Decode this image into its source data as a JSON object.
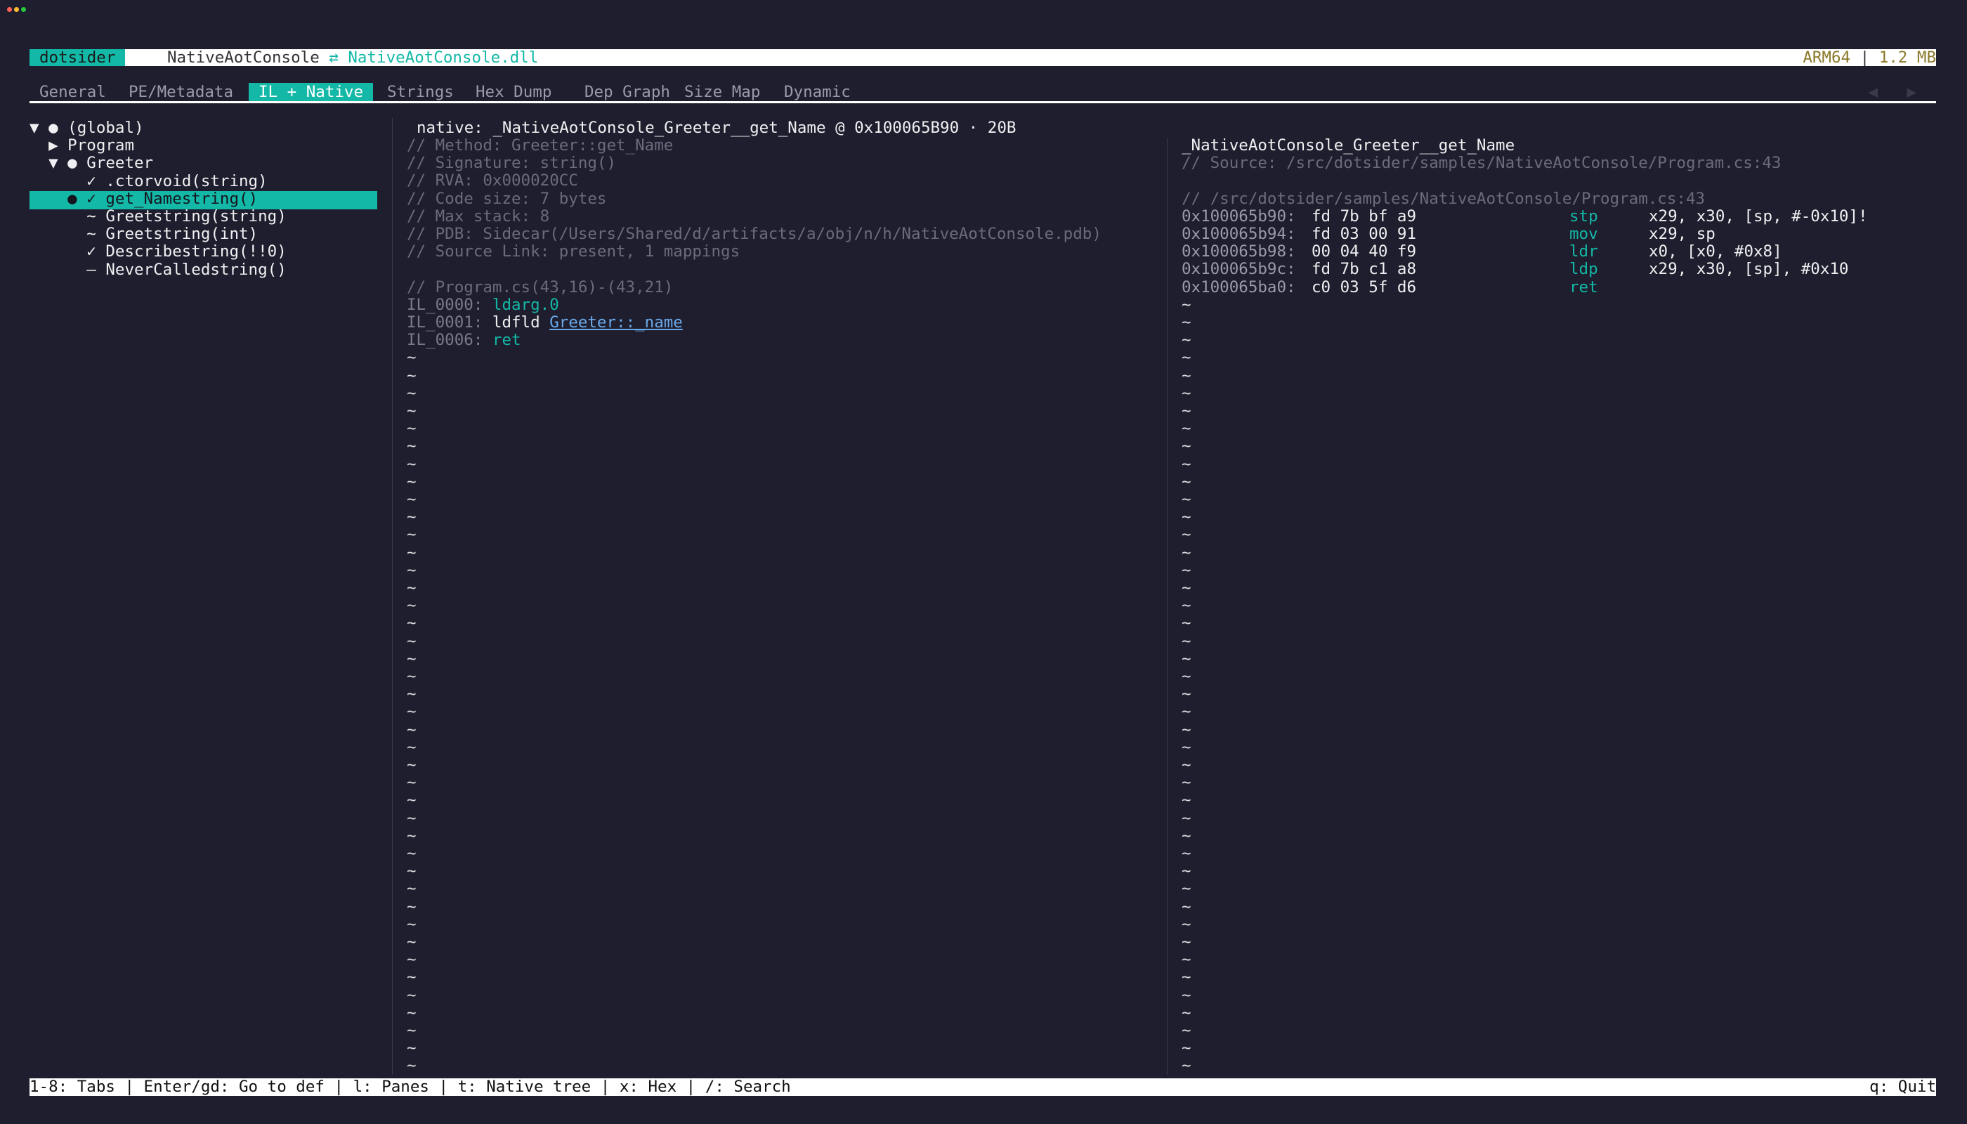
{
  "colors": {
    "accent": "#14b8a6",
    "background": "#1e1e2e",
    "link": "#6aa8e8",
    "arch": "#8a7a2a"
  },
  "titlebar": {
    "app": "dotsider",
    "project": "NativeAotConsole",
    "swap_glyph": "⇄",
    "file": "NativeAotConsole.dll",
    "arch": "ARM64",
    "separator": "|",
    "size": "1.2 MB"
  },
  "tabs": [
    "General",
    "PE/Metadata",
    "IL + Native",
    "Strings",
    "Hex Dump",
    "Dep Graph",
    "Size Map",
    "Dynamic"
  ],
  "active_tab": "IL + Native",
  "tab_arrows": "◀ ▶",
  "tree": [
    {
      "text": "▼ ● (global)",
      "selected": false
    },
    {
      "text": "  ▶ Program",
      "selected": false
    },
    {
      "text": "  ▼ ● Greeter",
      "selected": false
    },
    {
      "text": "      ✓ .ctorvoid(string)",
      "selected": false
    },
    {
      "text": "    ● ✓ get_Namestring()",
      "selected": true
    },
    {
      "text": "      ~ Greetstring(string)",
      "selected": false
    },
    {
      "text": "      ~ Greetstring(int)",
      "selected": false
    },
    {
      "text": "      ✓ Describestring(!!0)",
      "selected": false
    },
    {
      "text": "      — NeverCalledstring()",
      "selected": false
    }
  ],
  "il_pane": {
    "header": "native: _NativeAotConsole_Greeter__get_Name @ 0x100065B90 · 20B",
    "comments": [
      "// Method: Greeter::get_Name",
      "// Signature: string()",
      "// RVA: 0x000020CC",
      "// Code size: 7 bytes",
      "// Max stack: 8",
      "// PDB: Sidecar(/Users/Shared/d/artifacts/a/obj/n/h/NativeAotConsole.pdb)",
      "// Source Link: present, 1 mappings"
    ],
    "source_comment": "// Program.cs(43,16)-(43,21)",
    "instructions": [
      {
        "offset": "IL_0000:",
        "opcode": "ldarg.0",
        "operand": "",
        "operand_link": false
      },
      {
        "offset": "IL_0001:",
        "opcode": "ldfld",
        "operand": "Greeter::_name",
        "operand_link": true
      },
      {
        "offset": "IL_0006:",
        "opcode": "ret",
        "operand": "",
        "operand_link": false
      }
    ],
    "tilde_count": 41
  },
  "native_pane": {
    "header": "_NativeAotConsole_Greeter__get_Name",
    "source": "// Source: /src/dotsider/samples/NativeAotConsole/Program.cs:43",
    "file_comment": "// /src/dotsider/samples/NativeAotConsole/Program.cs:43",
    "instructions": [
      {
        "addr": "0x100065b90:",
        "bytes": "fd 7b bf a9",
        "mnemonic": "stp",
        "operands": "x29, x30, [sp, #-0x10]!"
      },
      {
        "addr": "0x100065b94:",
        "bytes": "fd 03 00 91",
        "mnemonic": "mov",
        "operands": "x29, sp"
      },
      {
        "addr": "0x100065b98:",
        "bytes": "00 04 40 f9",
        "mnemonic": "ldr",
        "operands": "x0, [x0, #0x8]"
      },
      {
        "addr": "0x100065b9c:",
        "bytes": "fd 7b c1 a8",
        "mnemonic": "ldp",
        "operands": "x29, x30, [sp], #0x10"
      },
      {
        "addr": "0x100065ba0:",
        "bytes": "c0 03 5f d6",
        "mnemonic": "ret",
        "operands": ""
      }
    ],
    "tilde_count": 44
  },
  "statusbar": {
    "hints": "1-8: Tabs | Enter/gd: Go to def | l: Panes | t: Native tree | x: Hex | /: Search",
    "quit": "q: Quit"
  }
}
